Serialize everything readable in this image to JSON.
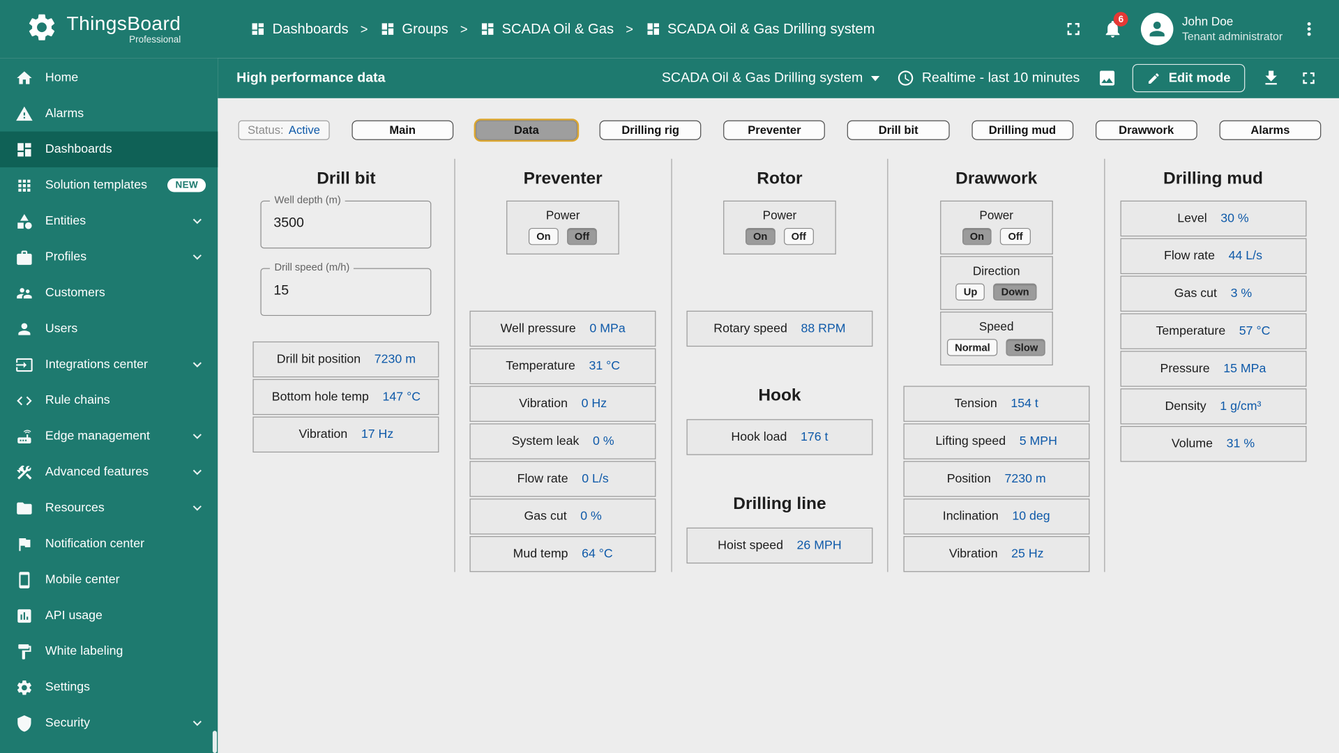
{
  "colors": {
    "teal": "#1e7a6f",
    "teal_dark": "#0f6156",
    "page_bg": "#ededed",
    "value_blue": "#0f5aa9",
    "selected_ring": "#dca62f",
    "badge_red": "#e53935"
  },
  "header": {
    "brand": "ThingsBoard",
    "brand_sub": "Professional",
    "breadcrumbs": [
      {
        "label": "Dashboards"
      },
      {
        "label": "Groups"
      },
      {
        "label": "SCADA Oil & Gas"
      },
      {
        "label": "SCADA Oil & Gas Drilling system"
      }
    ],
    "notifications_count": "6",
    "user_name": "John Doe",
    "user_role": "Tenant administrator"
  },
  "sidebar": {
    "items": [
      {
        "label": "Home",
        "icon": "home"
      },
      {
        "label": "Alarms",
        "icon": "warning"
      },
      {
        "label": "Dashboards",
        "icon": "dashboards",
        "active": true
      },
      {
        "label": "Solution templates",
        "icon": "apps",
        "badge": "NEW"
      },
      {
        "label": "Entities",
        "icon": "category",
        "chevron": true
      },
      {
        "label": "Profiles",
        "icon": "briefcase",
        "chevron": true
      },
      {
        "label": "Customers",
        "icon": "people"
      },
      {
        "label": "Users",
        "icon": "person"
      },
      {
        "label": "Integrations center",
        "icon": "input",
        "chevron": true
      },
      {
        "label": "Rule chains",
        "icon": "code"
      },
      {
        "label": "Edge management",
        "icon": "router",
        "chevron": true
      },
      {
        "label": "Advanced features",
        "icon": "construction",
        "chevron": true
      },
      {
        "label": "Resources",
        "icon": "folder",
        "chevron": true
      },
      {
        "label": "Notification center",
        "icon": "flag"
      },
      {
        "label": "Mobile center",
        "icon": "smartphone"
      },
      {
        "label": "API usage",
        "icon": "chart"
      },
      {
        "label": "White labeling",
        "icon": "paint"
      },
      {
        "label": "Settings",
        "icon": "gear"
      },
      {
        "label": "Security",
        "icon": "shield",
        "chevron": true
      }
    ]
  },
  "toolbar": {
    "title": "High performance data",
    "dashboard_select": "SCADA Oil & Gas Drilling system",
    "time_window": "Realtime - last 10 minutes",
    "edit_mode_label": "Edit mode"
  },
  "state_buttons": {
    "status_label": "Status:",
    "status_value": "Active",
    "buttons": [
      {
        "label": "Main"
      },
      {
        "label": "Data",
        "selected": true
      },
      {
        "label": "Drilling rig"
      },
      {
        "label": "Preventer"
      },
      {
        "label": "Drill bit"
      },
      {
        "label": "Drilling mud"
      },
      {
        "label": "Drawwork"
      },
      {
        "label": "Alarms"
      }
    ]
  },
  "panels": [
    {
      "key": "drill-bit",
      "sections": [
        {
          "key": "drill-bit",
          "title": "Drill bit",
          "inputs": [
            {
              "label": "Well depth (m)",
              "value": "3500"
            },
            {
              "label": "Drill speed (m/h)",
              "value": "15"
            }
          ],
          "readings": [
            {
              "label": "Drill bit position",
              "value": "7230 m"
            },
            {
              "label": "Bottom hole temp",
              "value": "147 °C"
            },
            {
              "label": "Vibration",
              "value": "17 Hz"
            }
          ]
        }
      ]
    },
    {
      "key": "preventer",
      "sections": [
        {
          "key": "preventer",
          "title": "Preventer",
          "toggles": [
            {
              "label": "Power",
              "options": [
                "On",
                "Off"
              ],
              "selected": "Off"
            }
          ],
          "readings": [
            {
              "label": "Well pressure",
              "value": "0 MPa"
            },
            {
              "label": "Temperature",
              "value": "31 °C"
            },
            {
              "label": "Vibration",
              "value": "0 Hz"
            },
            {
              "label": "System leak",
              "value": "0 %"
            },
            {
              "label": "Flow rate",
              "value": "0 L/s"
            },
            {
              "label": "Gas cut",
              "value": "0 %"
            },
            {
              "label": "Mud temp",
              "value": "64 °C"
            }
          ]
        }
      ]
    },
    {
      "key": "rotor",
      "sections": [
        {
          "key": "rotor",
          "title": "Rotor",
          "toggles": [
            {
              "label": "Power",
              "options": [
                "On",
                "Off"
              ],
              "selected": "On"
            }
          ],
          "readings": [
            {
              "label": "Rotary speed",
              "value": "88 RPM"
            }
          ]
        },
        {
          "key": "hook",
          "title": "Hook",
          "readings": [
            {
              "label": "Hook load",
              "value": "176 t"
            }
          ]
        },
        {
          "key": "drilling-line",
          "title": "Drilling line",
          "readings": [
            {
              "label": "Hoist speed",
              "value": "26 MPH"
            }
          ]
        }
      ]
    },
    {
      "key": "drawwork",
      "sections": [
        {
          "key": "drawwork",
          "title": "Drawwork",
          "toggles": [
            {
              "label": "Power",
              "options": [
                "On",
                "Off"
              ],
              "selected": "On"
            },
            {
              "label": "Direction",
              "options": [
                "Up",
                "Down"
              ],
              "selected": "Down"
            },
            {
              "label": "Speed",
              "options": [
                "Normal",
                "Slow"
              ],
              "selected": "Slow"
            }
          ],
          "readings": [
            {
              "label": "Tension",
              "value": "154 t"
            },
            {
              "label": "Lifting speed",
              "value": "5 MPH"
            },
            {
              "label": "Position",
              "value": "7230 m"
            },
            {
              "label": "Inclination",
              "value": "10 deg"
            },
            {
              "label": "Vibration",
              "value": "25 Hz"
            }
          ]
        }
      ]
    },
    {
      "key": "drilling-mud",
      "sections": [
        {
          "key": "drilling-mud",
          "title": "Drilling mud",
          "readings": [
            {
              "label": "Level",
              "value": "30 %"
            },
            {
              "label": "Flow rate",
              "value": "44 L/s"
            },
            {
              "label": "Gas cut",
              "value": "3 %"
            },
            {
              "label": "Temperature",
              "value": "57 °C"
            },
            {
              "label": "Pressure",
              "value": "15 MPa"
            },
            {
              "label": "Density",
              "value": "1 g/cm³"
            },
            {
              "label": "Volume",
              "value": "31 %"
            }
          ]
        }
      ]
    }
  ]
}
